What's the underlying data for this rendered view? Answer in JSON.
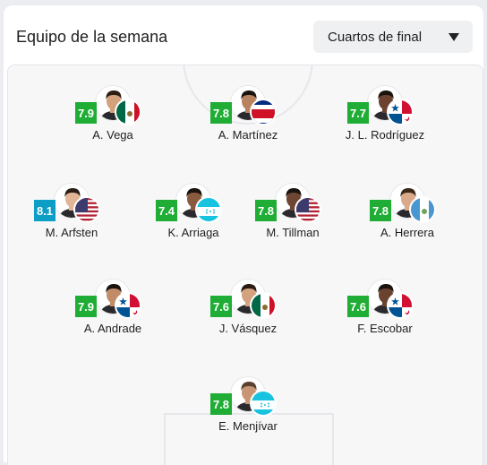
{
  "header": {
    "title": "Equipo de la semana",
    "round_select": {
      "value": "Cuartos de final",
      "icon": "chevron-down-icon"
    }
  },
  "colors": {
    "rating_green": "#1fad35",
    "rating_teal": "#0d9ec5"
  },
  "players": [
    {
      "name": "A. Vega",
      "rating": "7.9",
      "rating_color": "#1fad35",
      "flag": "mexico",
      "skin": "#d3a17c",
      "hair": "#2b1c14"
    },
    {
      "name": "A. Martínez",
      "rating": "7.8",
      "rating_color": "#1fad35",
      "flag": "costa-rica",
      "skin": "#b98260",
      "hair": "#1a1410"
    },
    {
      "name": "J. L. Rodríguez",
      "rating": "7.7",
      "rating_color": "#1fad35",
      "flag": "panama",
      "skin": "#6b4330",
      "hair": "#1a1410"
    },
    {
      "name": "M. Arfsten",
      "rating": "8.1",
      "rating_color": "#0d9ec5",
      "flag": "usa",
      "skin": "#e2b596",
      "hair": "#2a1e16"
    },
    {
      "name": "K. Arriaga",
      "rating": "7.4",
      "rating_color": "#1fad35",
      "flag": "honduras",
      "skin": "#8a5a3e",
      "hair": "#1a1410"
    },
    {
      "name": "M. Tillman",
      "rating": "7.8",
      "rating_color": "#1fad35",
      "flag": "usa",
      "skin": "#6e4633",
      "hair": "#1a1410"
    },
    {
      "name": "A. Herrera",
      "rating": "7.8",
      "rating_color": "#1fad35",
      "flag": "guatemala",
      "skin": "#d9a98a",
      "hair": "#3a2818"
    },
    {
      "name": "A. Andrade",
      "rating": "7.9",
      "rating_color": "#1fad35",
      "flag": "panama",
      "skin": "#c38c69",
      "hair": "#1a1410"
    },
    {
      "name": "J. Vásquez",
      "rating": "7.6",
      "rating_color": "#1fad35",
      "flag": "mexico",
      "skin": "#d4a27e",
      "hair": "#2a1c12"
    },
    {
      "name": "F. Escobar",
      "rating": "7.6",
      "rating_color": "#1fad35",
      "flag": "panama",
      "skin": "#6a4230",
      "hair": "#1a1410"
    },
    {
      "name": "E. Menjívar",
      "rating": "7.8",
      "rating_color": "#1fad35",
      "flag": "honduras",
      "skin": "#c89674",
      "hair": "#5a4030"
    }
  ]
}
